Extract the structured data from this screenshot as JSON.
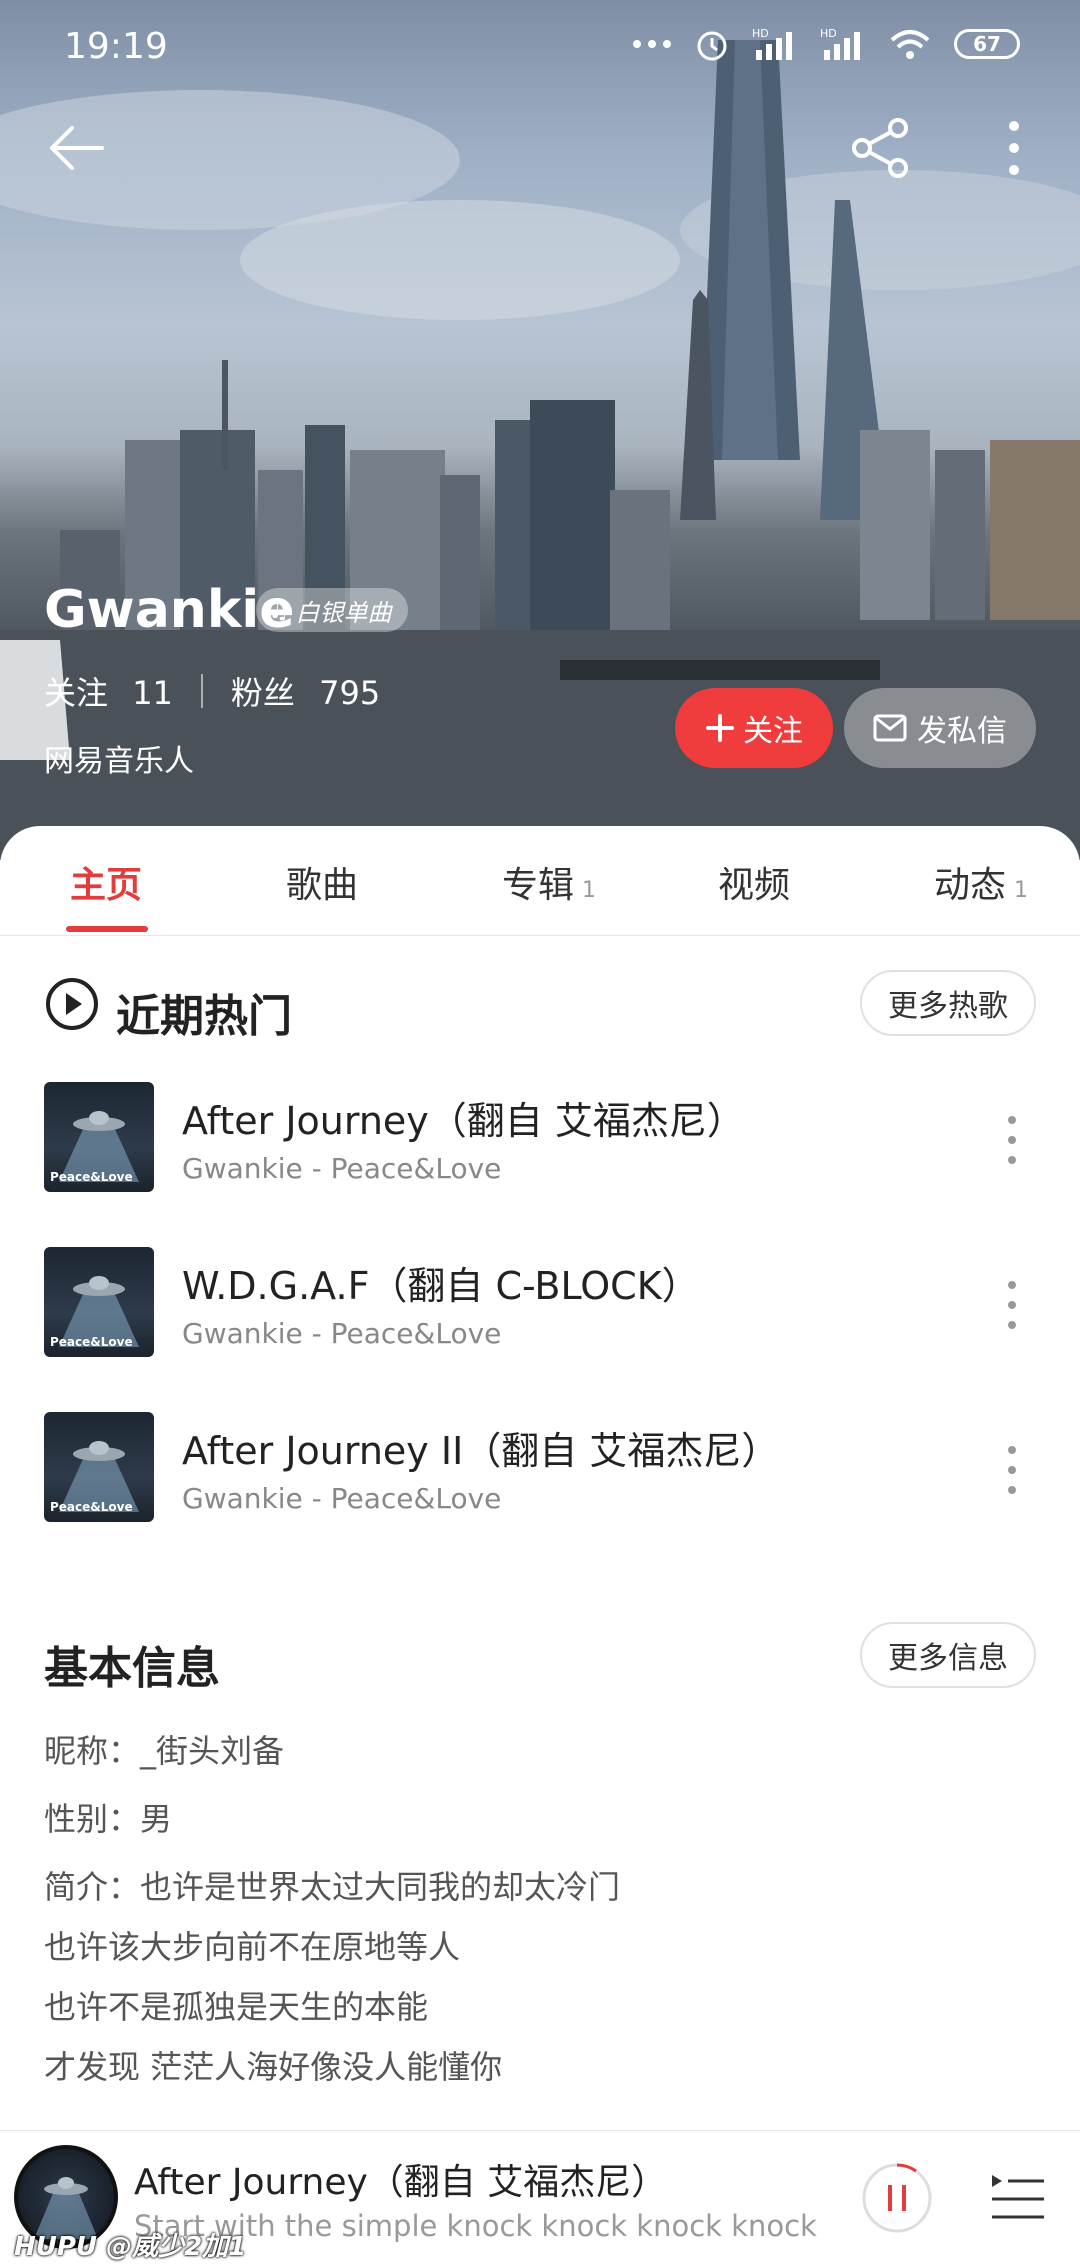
{
  "status_bar": {
    "time": "19:19",
    "battery": "67",
    "signal_label_1": "HD",
    "signal_label_2": "HD"
  },
  "header": {
    "artist_name": "Gwankie",
    "badge": "白银单曲",
    "following_label": "关注",
    "following_count": "11",
    "fans_label": "粉丝",
    "fans_count": "795",
    "role": "网易音乐人",
    "follow_button": "关注",
    "message_button": "发私信"
  },
  "tabs": [
    {
      "label": "主页",
      "count": ""
    },
    {
      "label": "歌曲",
      "count": ""
    },
    {
      "label": "专辑",
      "count": "1"
    },
    {
      "label": "视频",
      "count": ""
    },
    {
      "label": "动态",
      "count": "1"
    }
  ],
  "hot": {
    "title": "近期热门",
    "more_button": "更多热歌",
    "songs": [
      {
        "name": "After Journey（翻自 艾福杰尼）",
        "sub": "Gwankie - Peace&Love",
        "cover_text": "Peace&Love"
      },
      {
        "name": "W.D.G.A.F（翻自 C-BLOCK）",
        "sub": "Gwankie - Peace&Love",
        "cover_text": "Peace&Love"
      },
      {
        "name": "After Journey II（翻自 艾福杰尼）",
        "sub": "Gwankie - Peace&Love",
        "cover_text": "Peace&Love"
      }
    ]
  },
  "info": {
    "title": "基本信息",
    "more_button": "更多信息",
    "nickname": "昵称：_街头刘备",
    "gender": "性别：男",
    "bio_1": "简介：也许是世界太过大同我的却太冷门",
    "bio_2": "也许该大步向前不在原地等人",
    "bio_3": "也许不是孤独是天生的本能",
    "bio_4": "才发现 茫茫人海好像没人能懂你"
  },
  "player": {
    "title": "After Journey（翻自 艾福杰尼）",
    "lyric": "Start with the simple knock knock knock knock"
  },
  "watermark": "HUPU @威少2加1",
  "colors": {
    "accent": "#e43c3c",
    "follow_button": "#f03c3c"
  }
}
